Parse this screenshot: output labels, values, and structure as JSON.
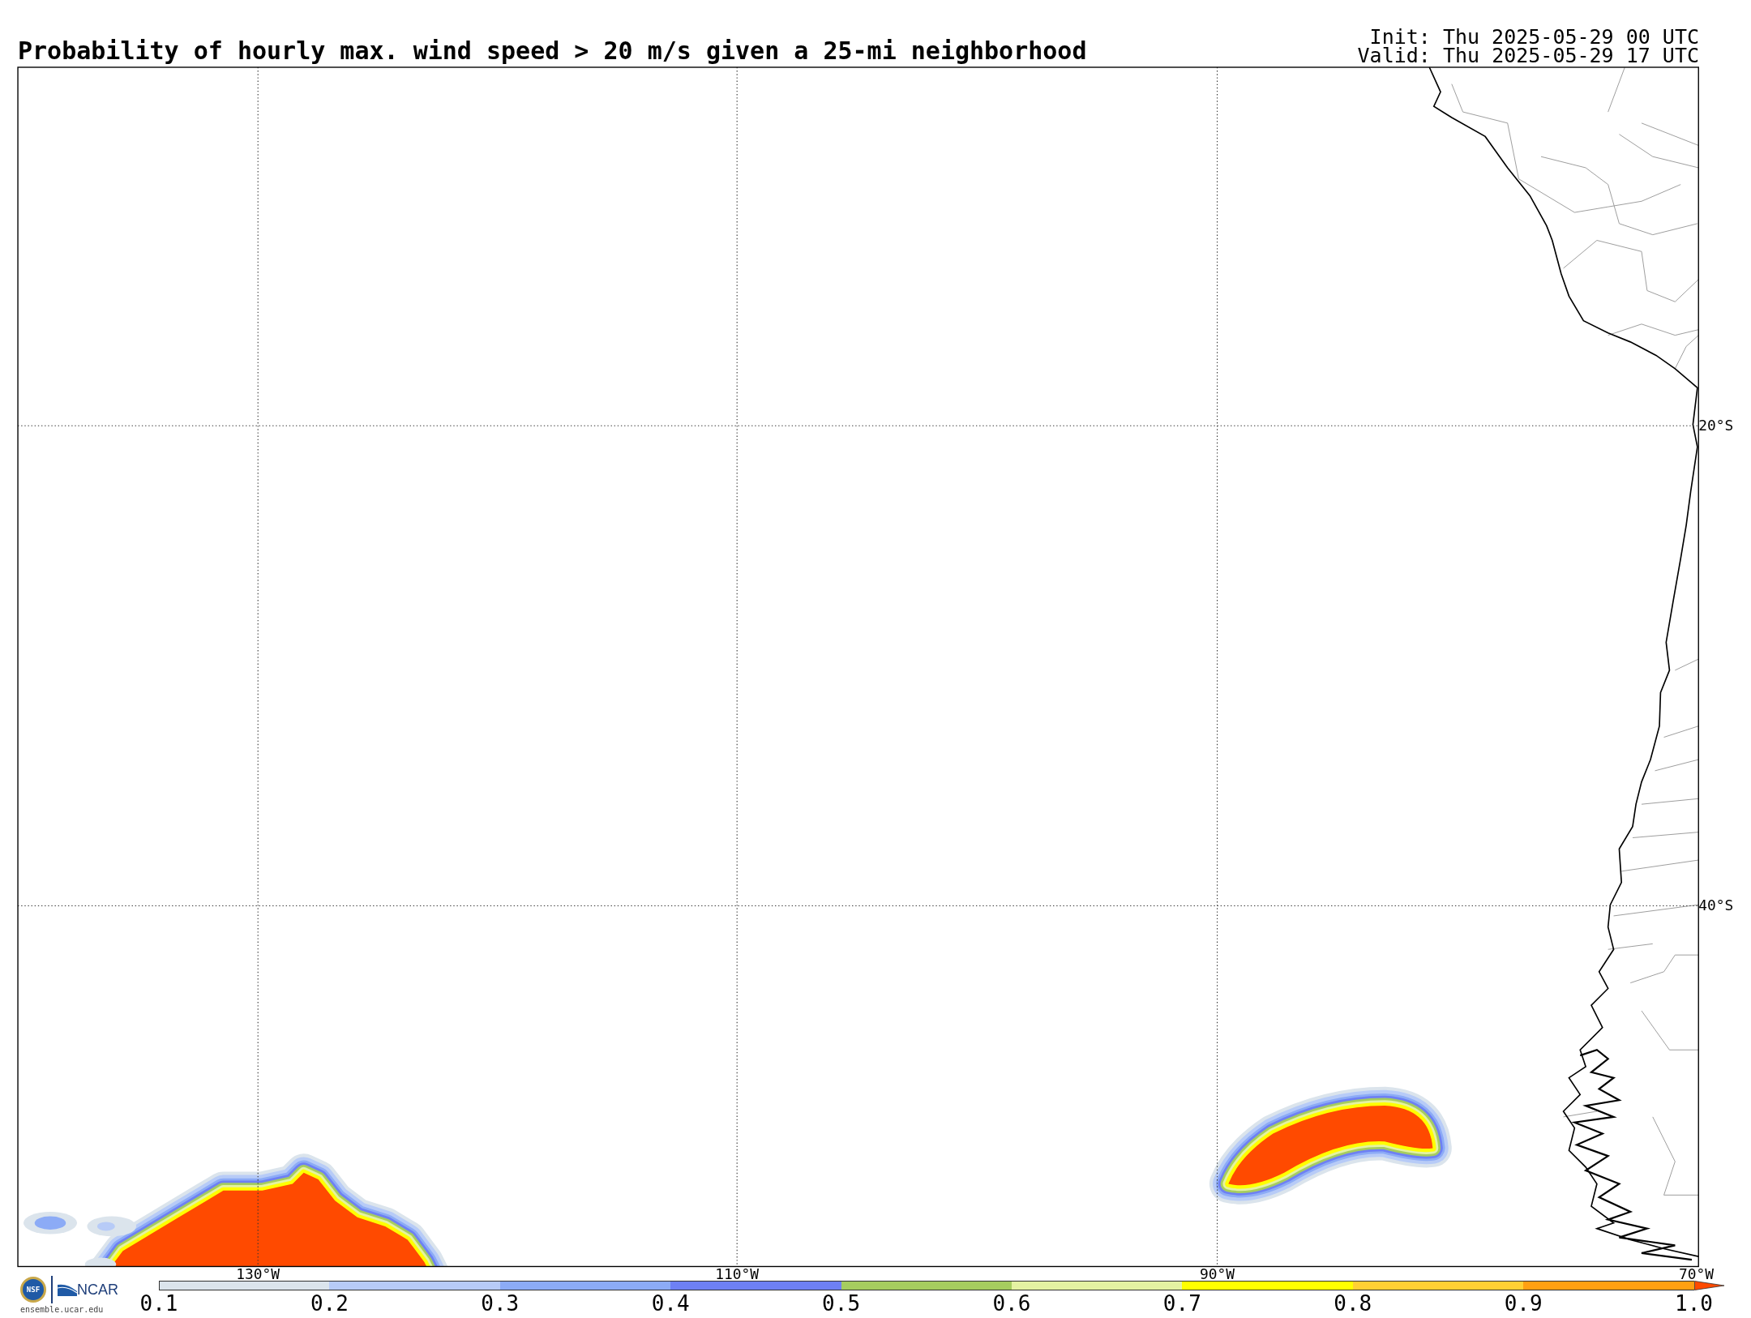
{
  "title": "Probability of hourly max. wind speed > 20 m/s given a 25-mi neighborhood",
  "init": "Init: Thu 2025-05-29 00 UTC",
  "valid": "Valid: Thu 2025-05-29 17 UTC",
  "map": {
    "lat_labels": [
      "20°S",
      "40°S"
    ],
    "lon_labels": [
      "130°W",
      "110°W",
      "90°W",
      "70°W"
    ]
  },
  "colorbar": {
    "segments": [
      {
        "kind": "box",
        "color": "#dbe4ec"
      },
      {
        "kind": "box",
        "color": "#b7cbf7"
      },
      {
        "kind": "box",
        "color": "#8cabf6"
      },
      {
        "kind": "box",
        "color": "#6e80f4"
      },
      {
        "kind": "box",
        "color": "#a6cd5f"
      },
      {
        "kind": "box",
        "color": "#e4f2a2"
      },
      {
        "kind": "box",
        "color": "#ffff00"
      },
      {
        "kind": "box",
        "color": "#ffd034"
      },
      {
        "kind": "box",
        "color": "#ffa012"
      },
      {
        "kind": "arrow",
        "color": "#ff4a00"
      }
    ],
    "tick_labels": [
      "0.1",
      "0.2",
      "0.3",
      "0.4",
      "0.5",
      "0.6",
      "0.7",
      "0.8",
      "0.9",
      "1.0"
    ]
  },
  "logos": {
    "seal_text": "NSF",
    "org": "NCAR",
    "site": "ensemble.ucar.edu"
  }
}
